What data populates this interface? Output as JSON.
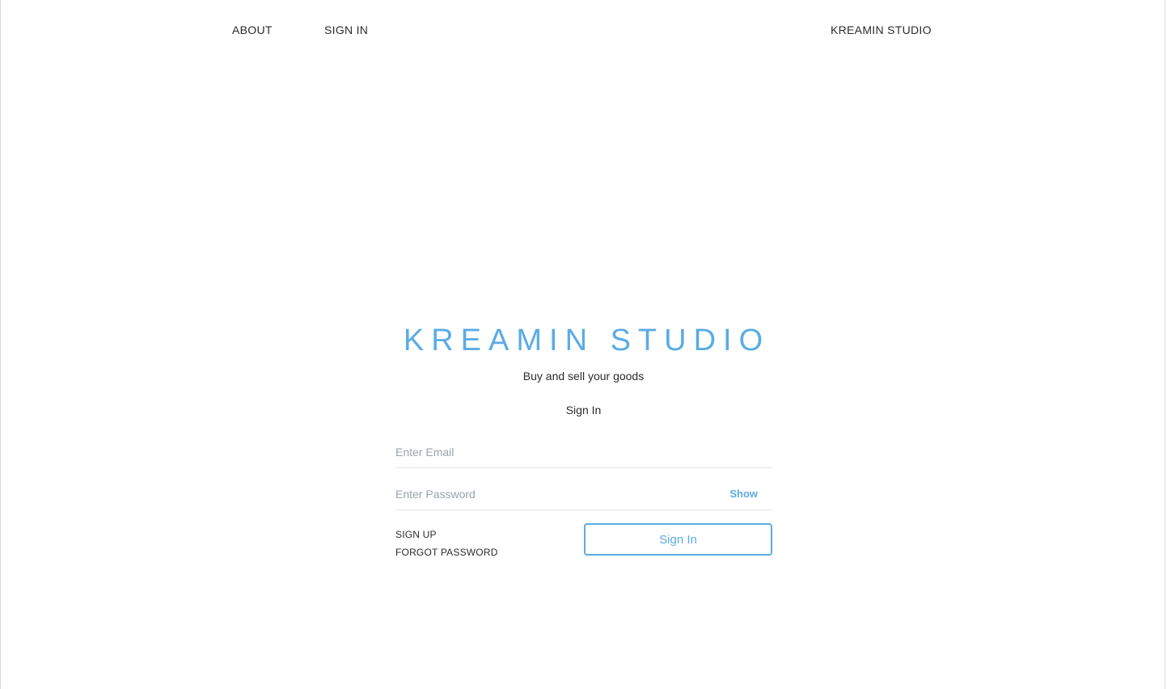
{
  "nav": {
    "about": "ABOUT",
    "sign_in": "SIGN IN",
    "brand": "KREAMIN STUDIO"
  },
  "hero": {
    "title": "KREAMIN STUDIO",
    "tagline": "Buy and sell your goods"
  },
  "form": {
    "heading": "Sign In",
    "email": {
      "placeholder": "Enter Email",
      "value": ""
    },
    "password": {
      "placeholder": "Enter Password",
      "value": "",
      "toggle_label": "Show"
    },
    "sign_up_link": "SIGN UP",
    "forgot_password_link": "FORGOT PASSWORD",
    "submit_label": "Sign In"
  },
  "colors": {
    "accent": "#5aace4",
    "text": "#2b2b2b",
    "placeholder": "#9aa3aa",
    "divider": "#e3e3e3"
  }
}
